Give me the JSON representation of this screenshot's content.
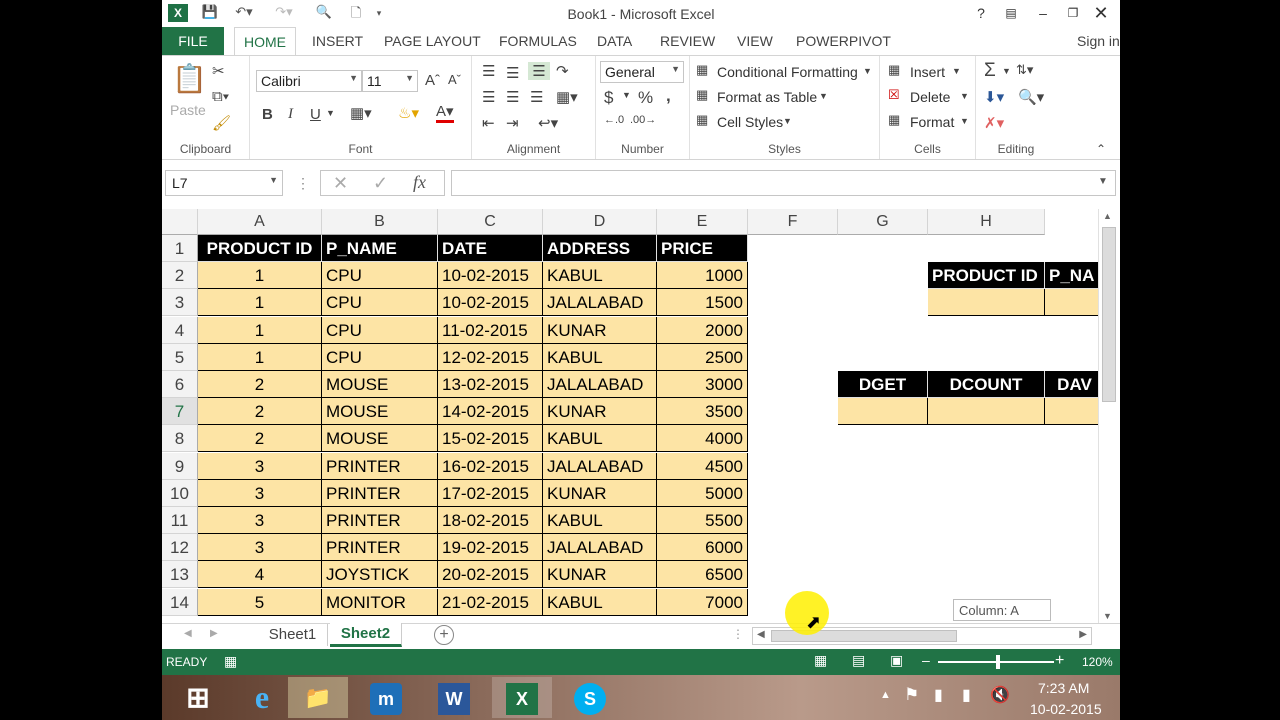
{
  "app": {
    "title": "Book1 - Microsoft Excel",
    "sign_in": "Sign in"
  },
  "tabs": [
    "FILE",
    "HOME",
    "INSERT",
    "PAGE LAYOUT",
    "FORMULAS",
    "DATA",
    "REVIEW",
    "VIEW",
    "POWERPIVOT"
  ],
  "ribbon": {
    "clipboard": {
      "label": "Clipboard",
      "paste": "Paste"
    },
    "font": {
      "label": "Font",
      "name": "Calibri",
      "size": "11",
      "bold": "B",
      "italic": "I",
      "underline": "U"
    },
    "alignment": {
      "label": "Alignment"
    },
    "number": {
      "label": "Number",
      "format": "General",
      "currency": "$",
      "percent": "%",
      "comma": ","
    },
    "styles": {
      "label": "Styles",
      "conditional": "Conditional Formatting",
      "format_table": "Format as Table",
      "cell_styles": "Cell Styles"
    },
    "cells": {
      "label": "Cells",
      "insert": "Insert",
      "delete": "Delete",
      "format": "Format"
    },
    "editing": {
      "label": "Editing",
      "sum": "Σ"
    }
  },
  "formula_bar": {
    "name_box": "L7",
    "fx": "fx",
    "value": ""
  },
  "columns": [
    "A",
    "B",
    "C",
    "D",
    "E",
    "F",
    "G",
    "H"
  ],
  "rows": [
    "1",
    "2",
    "3",
    "4",
    "5",
    "6",
    "7",
    "8",
    "9",
    "10",
    "11",
    "12",
    "13",
    "14"
  ],
  "table": {
    "headers": [
      "PRODUCT ID",
      "P_NAME",
      "DATE",
      "ADDRESS",
      "PRICE"
    ],
    "data": [
      [
        "1",
        "CPU",
        "10-02-2015",
        "KABUL",
        "1000"
      ],
      [
        "1",
        "CPU",
        "10-02-2015",
        "JALALABAD",
        "1500"
      ],
      [
        "1",
        "CPU",
        "11-02-2015",
        "KUNAR",
        "2000"
      ],
      [
        "1",
        "CPU",
        "12-02-2015",
        "KABUL",
        "2500"
      ],
      [
        "2",
        "MOUSE",
        "13-02-2015",
        "JALALABAD",
        "3000"
      ],
      [
        "2",
        "MOUSE",
        "14-02-2015",
        "KUNAR",
        "3500"
      ],
      [
        "2",
        "MOUSE",
        "15-02-2015",
        "KABUL",
        "4000"
      ],
      [
        "3",
        "PRINTER",
        "16-02-2015",
        "JALALABAD",
        "4500"
      ],
      [
        "3",
        "PRINTER",
        "17-02-2015",
        "KUNAR",
        "5000"
      ],
      [
        "3",
        "PRINTER",
        "18-02-2015",
        "KABUL",
        "5500"
      ],
      [
        "3",
        "PRINTER",
        "19-02-2015",
        "JALALABAD",
        "6000"
      ],
      [
        "4",
        "JOYSTICK",
        "20-02-2015",
        "KUNAR",
        "6500"
      ],
      [
        "5",
        "MONITOR",
        "21-02-2015",
        "KABUL",
        "7000"
      ]
    ]
  },
  "criteria": {
    "h1": "PRODUCT ID",
    "h2": "P_NA"
  },
  "functions": {
    "f1": "DGET",
    "f2": "DCOUNT",
    "f3": "DAV"
  },
  "tooltip": "Column: A",
  "sheets": [
    "Sheet1",
    "Sheet2"
  ],
  "active_sheet": "Sheet2",
  "status": {
    "mode": "READY",
    "zoom": "120%"
  },
  "clock": {
    "time": "7:23 AM",
    "date": "10-02-2015"
  },
  "colors": {
    "excel_green": "#217346",
    "data_fill": "#fde4a5"
  }
}
